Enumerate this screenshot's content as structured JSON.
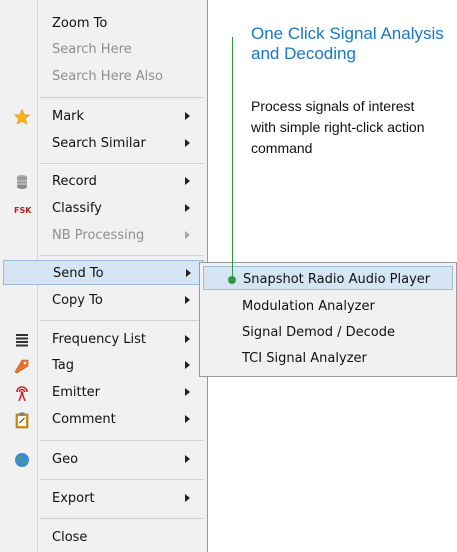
{
  "menu": {
    "items": [
      {
        "label": "Zoom To"
      },
      {
        "label": "Search Here"
      },
      {
        "label": "Search Here Also"
      },
      {
        "label": "Mark",
        "icon": "star-icon"
      },
      {
        "label": "Search Similar"
      },
      {
        "label": "Record",
        "icon": "database-icon"
      },
      {
        "label": "Classify",
        "icon": "fsk-icon",
        "icon_text": "FSK"
      },
      {
        "label": "NB Processing"
      },
      {
        "label": "Send To"
      },
      {
        "label": "Copy To"
      },
      {
        "label": "Frequency List",
        "icon": "list-icon"
      },
      {
        "label": "Tag",
        "icon": "tag-icon"
      },
      {
        "label": "Emitter",
        "icon": "antenna-icon"
      },
      {
        "label": "Comment",
        "icon": "clipboard-icon"
      },
      {
        "label": "Geo",
        "icon": "globe-icon"
      },
      {
        "label": "Export"
      },
      {
        "label": "Close"
      }
    ]
  },
  "submenu": {
    "items": [
      {
        "label": "Snapshot Radio Audio Player"
      },
      {
        "label": "Modulation Analyzer"
      },
      {
        "label": "Signal Demod / Decode"
      },
      {
        "label": "TCI Signal Analyzer"
      }
    ]
  },
  "callout": {
    "title": "One Click Signal Analysis and Decoding",
    "body": "Process signals of interest with simple right-click action command"
  },
  "colors": {
    "accent_title": "#1a78c2",
    "callout_line": "#2f9a3e",
    "selection": "#d6e5f4"
  }
}
